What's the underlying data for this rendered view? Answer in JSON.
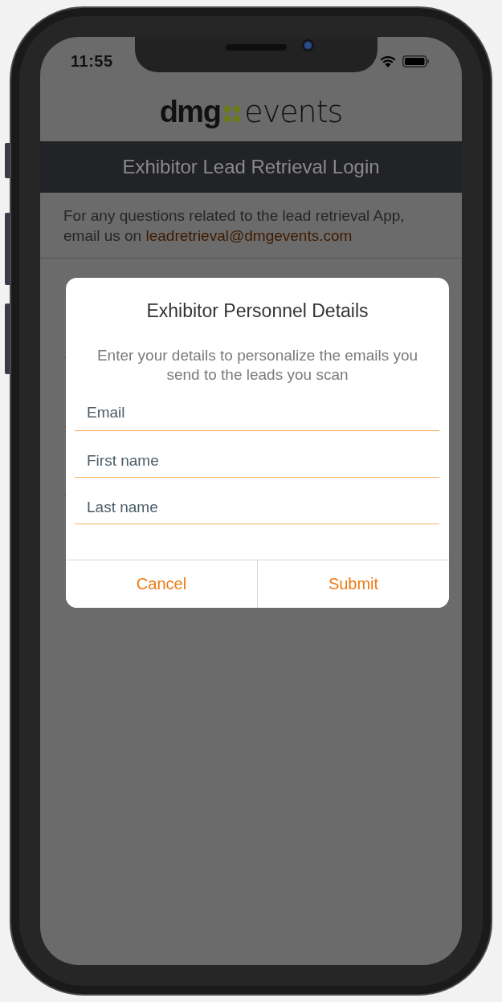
{
  "status_bar": {
    "time": "11:55"
  },
  "logo": {
    "word_1": "dmg",
    "word_2": "events"
  },
  "header": {
    "title": "Exhibitor Lead Retrieval Login"
  },
  "info": {
    "text": "For any questions related to the lead retrieval App, email us on ",
    "link": "leadretrieval@dmgevents.com"
  },
  "dialog": {
    "title": "Exhibitor Personnel Details",
    "message": "Enter your details to personalize the emails you send to the leads you scan",
    "fields": [
      {
        "placeholder": "Email"
      },
      {
        "placeholder": "First name"
      },
      {
        "placeholder": "Last name"
      }
    ],
    "buttons": [
      {
        "label": "Cancel"
      },
      {
        "label": "Submit"
      }
    ]
  }
}
